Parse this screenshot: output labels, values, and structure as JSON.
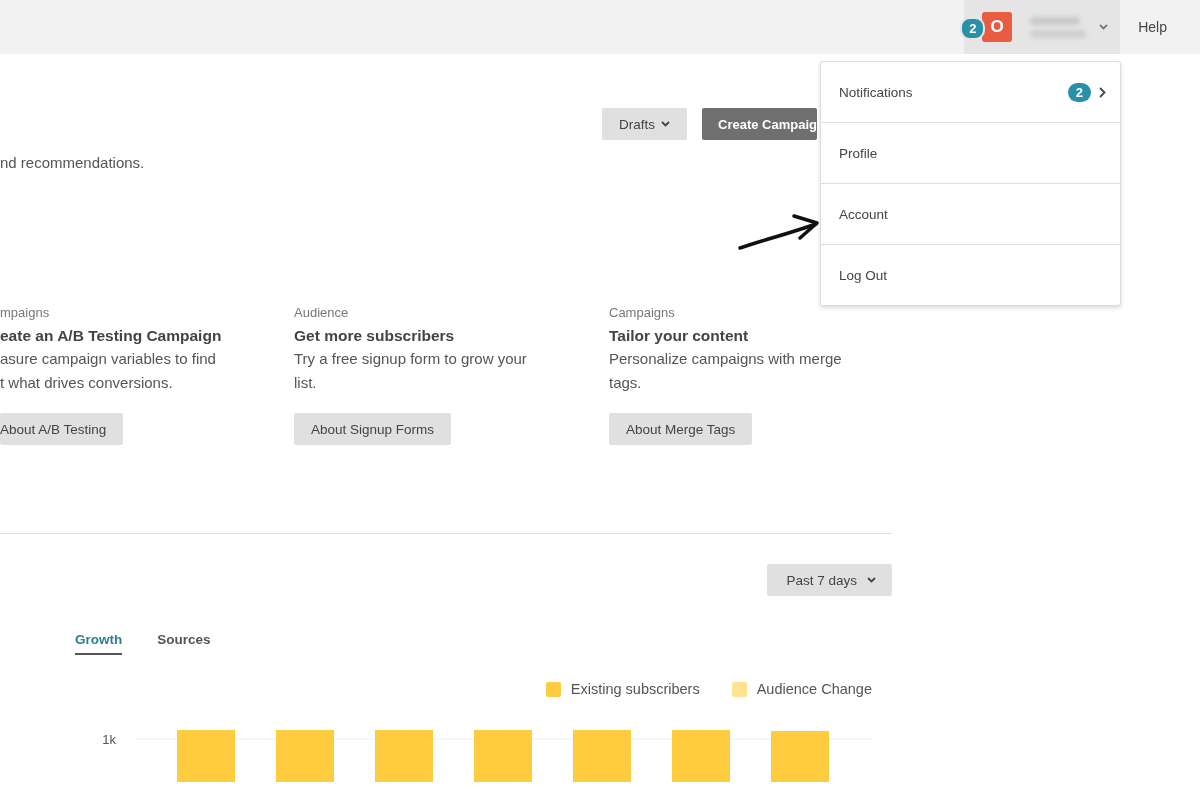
{
  "header": {
    "notification_count": "2",
    "avatar_letter": "O",
    "help": "Help"
  },
  "account_menu": {
    "items": [
      {
        "label": "Notifications",
        "badge": "2",
        "has_submenu": true
      },
      {
        "label": "Profile",
        "has_submenu": false
      },
      {
        "label": "Account",
        "has_submenu": false
      },
      {
        "label": "Log Out",
        "has_submenu": false
      }
    ]
  },
  "toolbar": {
    "drafts": "Drafts",
    "create": "Create Campaig"
  },
  "intro": "nd recommendations.",
  "cards": [
    {
      "category": "mpaigns",
      "title": "eate an A/B Testing Campaign",
      "description_lines": [
        "asure campaign variables to find",
        "t what drives conversions."
      ],
      "button": "About A/B Testing"
    },
    {
      "category": "Audience",
      "title": "Get more subscribers",
      "description_lines": [
        "Try a free signup form to grow your",
        "list."
      ],
      "button": "About Signup Forms"
    },
    {
      "category": "Campaigns",
      "title": "Tailor your content",
      "description_lines": [
        "Personalize campaigns with merge",
        "tags."
      ],
      "button": "About Merge Tags"
    }
  ],
  "growth": {
    "range": "Past 7 days",
    "tabs": [
      {
        "label": "Growth",
        "selected": true
      },
      {
        "label": "Sources",
        "selected": false
      }
    ],
    "legend": [
      {
        "label": "Existing subscribers",
        "color": "#ffcc3f"
      },
      {
        "label": "Audience Change",
        "color": "#ffe390"
      }
    ],
    "y_tick": "1k"
  }
}
